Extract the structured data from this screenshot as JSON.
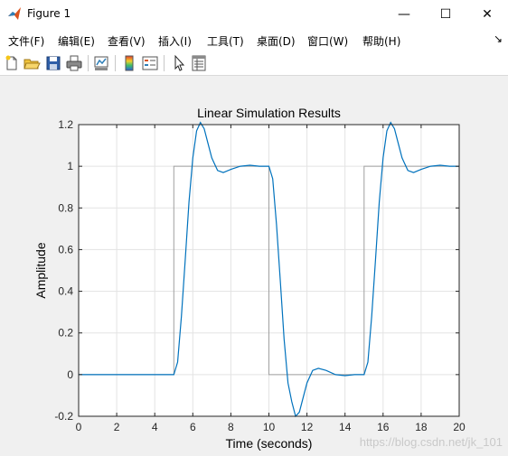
{
  "window": {
    "title": "Figure 1",
    "minimize_glyph": "—",
    "maximize_glyph": "☐",
    "close_glyph": "✕"
  },
  "menu": {
    "items": [
      {
        "label": "文件(F)"
      },
      {
        "label": "编辑(E)"
      },
      {
        "label": "查看(V)"
      },
      {
        "label": "插入(I)"
      },
      {
        "label": "工具(T)"
      },
      {
        "label": "桌面(D)"
      },
      {
        "label": "窗口(W)"
      },
      {
        "label": "帮助(H)"
      }
    ],
    "overflow_glyph": "↘"
  },
  "toolbar": {
    "icons": [
      "new-figure-icon",
      "open-file-icon",
      "save-icon",
      "print-icon",
      "link-plot-icon",
      "insert-colorbar-icon",
      "insert-legend-icon",
      "edit-plot-icon",
      "property-inspector-icon"
    ]
  },
  "watermark": "https://blog.csdn.net/jk_101",
  "chart_data": {
    "type": "line",
    "title": "Linear Simulation Results",
    "xlabel": "Time (seconds)",
    "ylabel": "Amplitude",
    "xlim": [
      0,
      20
    ],
    "ylim": [
      -0.2,
      1.2
    ],
    "xticks": [
      "0",
      "2",
      "4",
      "6",
      "8",
      "10",
      "12",
      "14",
      "16",
      "18",
      "20"
    ],
    "yticks": [
      "-0.2",
      "0",
      "0.2",
      "0.4",
      "0.6",
      "0.8",
      "1",
      "1.2"
    ],
    "grid": true,
    "colors": {
      "input": "#a0a0a0",
      "response": "#0072bd"
    },
    "series": [
      {
        "role": "input",
        "x": [
          0,
          5,
          5,
          10,
          10,
          15,
          15,
          20
        ],
        "y": [
          0,
          0,
          1,
          1,
          0,
          0,
          1,
          1
        ]
      },
      {
        "role": "response",
        "x": [
          0,
          5,
          5.2,
          5.4,
          5.6,
          5.8,
          6.0,
          6.2,
          6.4,
          6.6,
          6.8,
          7.0,
          7.3,
          7.6,
          8.0,
          8.5,
          9.0,
          9.5,
          10,
          10.2,
          10.4,
          10.6,
          10.8,
          11.0,
          11.2,
          11.4,
          11.6,
          11.8,
          12.0,
          12.3,
          12.6,
          13.0,
          13.5,
          14.0,
          14.5,
          15,
          15.2,
          15.4,
          15.6,
          15.8,
          16.0,
          16.2,
          16.4,
          16.6,
          16.8,
          17.0,
          17.3,
          17.6,
          18.0,
          18.5,
          19.0,
          19.5,
          20
        ],
        "y": [
          0,
          0,
          0.06,
          0.28,
          0.55,
          0.83,
          1.04,
          1.17,
          1.21,
          1.18,
          1.11,
          1.04,
          0.98,
          0.97,
          0.985,
          1.0,
          1.005,
          1.0,
          1.0,
          0.94,
          0.72,
          0.45,
          0.17,
          -0.04,
          -0.13,
          -0.2,
          -0.18,
          -0.11,
          -0.04,
          0.02,
          0.03,
          0.02,
          0.0,
          -0.005,
          0.0,
          0.0,
          0.06,
          0.28,
          0.55,
          0.83,
          1.04,
          1.17,
          1.21,
          1.18,
          1.11,
          1.04,
          0.98,
          0.97,
          0.985,
          1.0,
          1.005,
          1.0,
          1.0
        ]
      }
    ]
  }
}
